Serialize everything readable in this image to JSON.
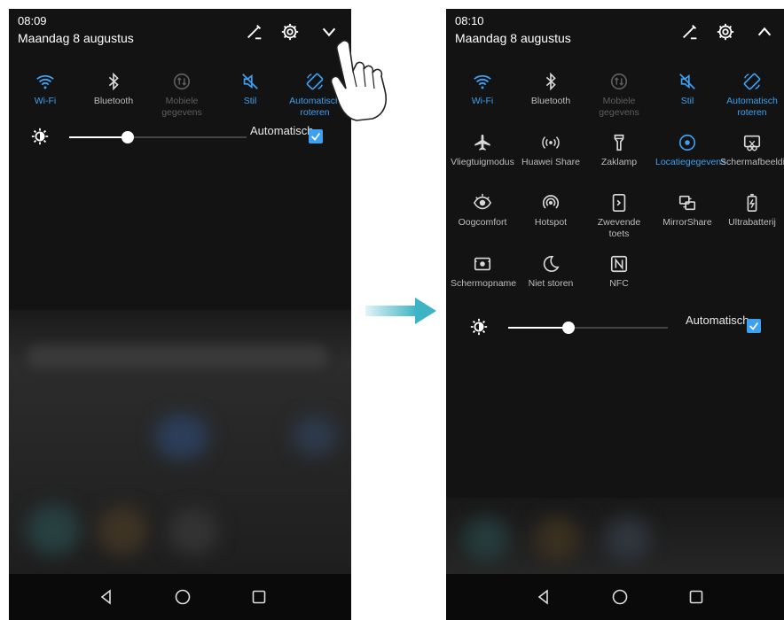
{
  "colors": {
    "accent": "#3ea0f0",
    "panel": "#131313",
    "arrow": "#3cb4c4"
  },
  "before": {
    "time": "08:09",
    "date": "Maandag 8 augustus",
    "header_icons": [
      "edit-icon",
      "settings-icon",
      "chevron-down-icon"
    ],
    "toggles": [
      {
        "label": "Wi-Fi",
        "icon": "wifi-icon",
        "state": "active"
      },
      {
        "label": "Bluetooth",
        "icon": "bluetooth-icon",
        "state": "off"
      },
      {
        "label": "Mobiele gegevens",
        "icon": "mobile-data-icon",
        "state": "disabled"
      },
      {
        "label": "Stil",
        "icon": "silent-icon",
        "state": "active"
      },
      {
        "label": "Automatisch roteren",
        "icon": "rotate-icon",
        "state": "active"
      }
    ],
    "brightness": {
      "level": 0.33,
      "auto_label": "Automatisch",
      "auto_checked": true
    }
  },
  "after": {
    "time": "08:10",
    "date": "Maandag 8 augustus",
    "header_icons": [
      "edit-icon",
      "settings-icon",
      "chevron-up-icon"
    ],
    "toggles": [
      {
        "label": "Wi-Fi",
        "icon": "wifi-icon",
        "state": "active"
      },
      {
        "label": "Bluetooth",
        "icon": "bluetooth-icon",
        "state": "off"
      },
      {
        "label": "Mobiele gegevens",
        "icon": "mobile-data-icon",
        "state": "disabled"
      },
      {
        "label": "Stil",
        "icon": "silent-icon",
        "state": "active"
      },
      {
        "label": "Automatisch roteren",
        "icon": "rotate-icon",
        "state": "active"
      },
      {
        "label": "Vliegtuigmodus",
        "icon": "airplane-icon",
        "state": "off"
      },
      {
        "label": "Huawei Share",
        "icon": "share-icon",
        "state": "off"
      },
      {
        "label": "Zaklamp",
        "icon": "flashlight-icon",
        "state": "off"
      },
      {
        "label": "Locatiegegevens",
        "icon": "location-icon",
        "state": "active"
      },
      {
        "label": "Schermafbeelding",
        "icon": "screenshot-icon",
        "state": "off"
      },
      {
        "label": "Oogcomfort",
        "icon": "eye-icon",
        "state": "off"
      },
      {
        "label": "Hotspot",
        "icon": "hotspot-icon",
        "state": "off"
      },
      {
        "label": "Zwevende toets",
        "icon": "floating-button-icon",
        "state": "off"
      },
      {
        "label": "MirrorShare",
        "icon": "mirror-icon",
        "state": "off"
      },
      {
        "label": "Ultrabatterij",
        "icon": "battery-icon",
        "state": "off"
      },
      {
        "label": "Schermopname",
        "icon": "screen-record-icon",
        "state": "off"
      },
      {
        "label": "Niet storen",
        "icon": "moon-icon",
        "state": "off"
      },
      {
        "label": "NFC",
        "icon": "nfc-icon",
        "state": "off"
      }
    ],
    "brightness": {
      "level": 0.38,
      "auto_label": "Automatisch",
      "auto_checked": true
    }
  },
  "nav": [
    "back-icon",
    "home-icon",
    "recents-icon"
  ]
}
